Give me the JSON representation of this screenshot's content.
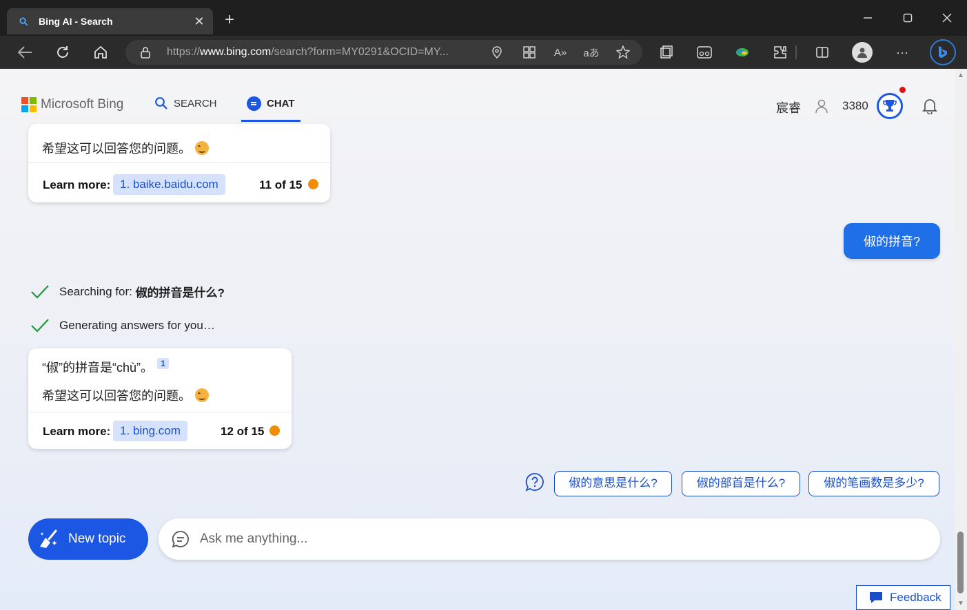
{
  "browser": {
    "tab_title": "Bing AI - Search",
    "url_prefix": "https://",
    "url_host": "www.bing.com",
    "url_path": "/search?form=MY0291&OCID=MY..."
  },
  "header": {
    "brand": "Microsoft Bing",
    "nav_search": "SEARCH",
    "nav_chat": "CHAT",
    "user_name": "宸睿",
    "points": "3380"
  },
  "chat": {
    "prev_answer": {
      "text": "希望这可以回答您的问题。",
      "learn_more_label": "Learn more:",
      "link": "1. baike.baidu.com",
      "counter": "11 of 15"
    },
    "user_message": "俶的拼音?",
    "status": {
      "searching_prefix": "Searching for: ",
      "searching_query": "俶的拼音是什么?",
      "generating": "Generating answers for you…"
    },
    "answer": {
      "line1": "“俶”的拼音是“chù”。",
      "citation": "1",
      "line2": "希望这可以回答您的问题。",
      "learn_more_label": "Learn more:",
      "link": "1. bing.com",
      "counter": "12 of 15"
    },
    "suggestions": [
      "俶的意思是什么?",
      "俶的部首是什么?",
      "俶的笔画数是多少?"
    ]
  },
  "composer": {
    "new_topic": "New topic",
    "placeholder": "Ask me anything..."
  },
  "feedback": "Feedback",
  "colors": {
    "accent": "#1b57e3",
    "user_bubble": "#1f6fe8",
    "counter_dot": "#f08c00",
    "check": "#1a9c3b"
  }
}
